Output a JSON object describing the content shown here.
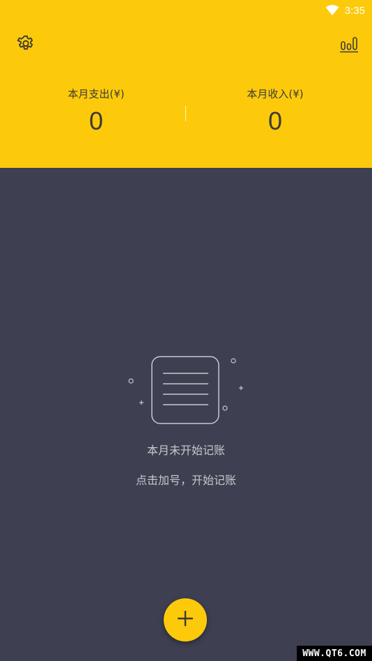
{
  "status_bar": {
    "time": "3:35",
    "icon": "wifi-icon"
  },
  "header": {
    "settings_icon": "gear-icon",
    "stats_icon": "bar-chart-icon",
    "background": "#fcca0b"
  },
  "summary": {
    "expense_label": "本月支出(¥)",
    "expense_value": "0",
    "income_label": "本月收入(¥)",
    "income_value": "0"
  },
  "empty_state": {
    "icon": "notebook-icon",
    "title": "本月未开始记账",
    "hint": "点击加号，开始记账"
  },
  "fab": {
    "icon": "plus-icon"
  },
  "watermark": "WWW.QT6.COM",
  "colors": {
    "accent": "#fcca0b",
    "body_bg": "#3e3f51",
    "text_muted": "#c8c8cc"
  }
}
